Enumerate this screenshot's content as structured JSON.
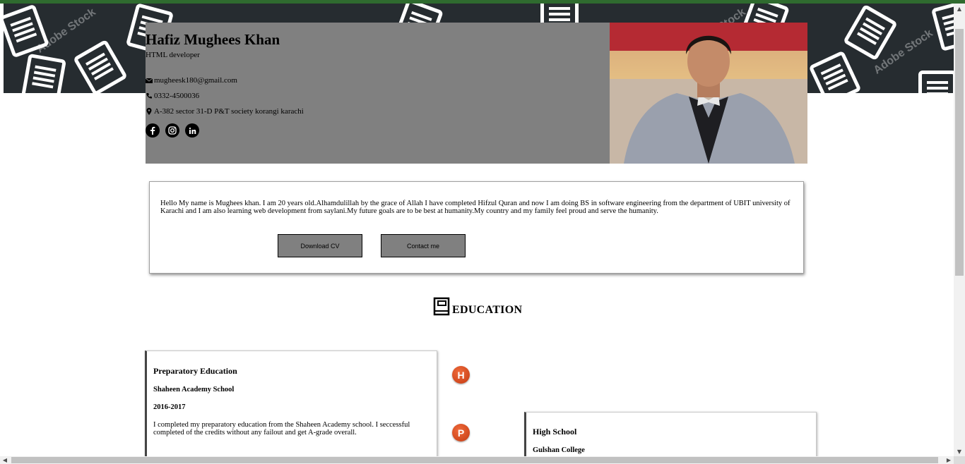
{
  "header": {
    "name": "Hafiz Mughees Khan",
    "role": "HTML developer",
    "email": "mugheesk180@gmail.com",
    "phone": "0332-4500036",
    "address": "A-382 sector 31-D P&T society korangi karachi",
    "social": [
      "facebook-icon",
      "instagram-icon",
      "linkedin-icon"
    ]
  },
  "about": {
    "text": "Hello My name is Mughees khan. I am 20 years old.Alhamdulillah by the grace of Allah I have completed Hifzul Quran and now I am doing BS in software engineering from the department of UBIT university of Karachi and I am also learning web development from saylani.My future goals are to be best at humanity.My country and my family feel proud and serve the humanity.",
    "download_label": "Download CV",
    "contact_label": "Contact me"
  },
  "education": {
    "heading": "EDUCATION",
    "items": [
      {
        "title": "Preparatory Education",
        "school": "Shaheen Academy School",
        "years": "2016-2017",
        "desc": "I completed my preparatory education from the Shaheen Academy school. I seccessful completed of the credits without any failout and get A-grade overall.",
        "badge": "H"
      },
      {
        "title": "High School",
        "school": "Gulshan College",
        "badge": "P"
      }
    ]
  },
  "banner": {
    "watermark": "Adobe Stock"
  },
  "colors": {
    "banner": "#262c30",
    "panel": "#808080",
    "badge": "#e0501f",
    "topbar": "#2f6b2f"
  }
}
